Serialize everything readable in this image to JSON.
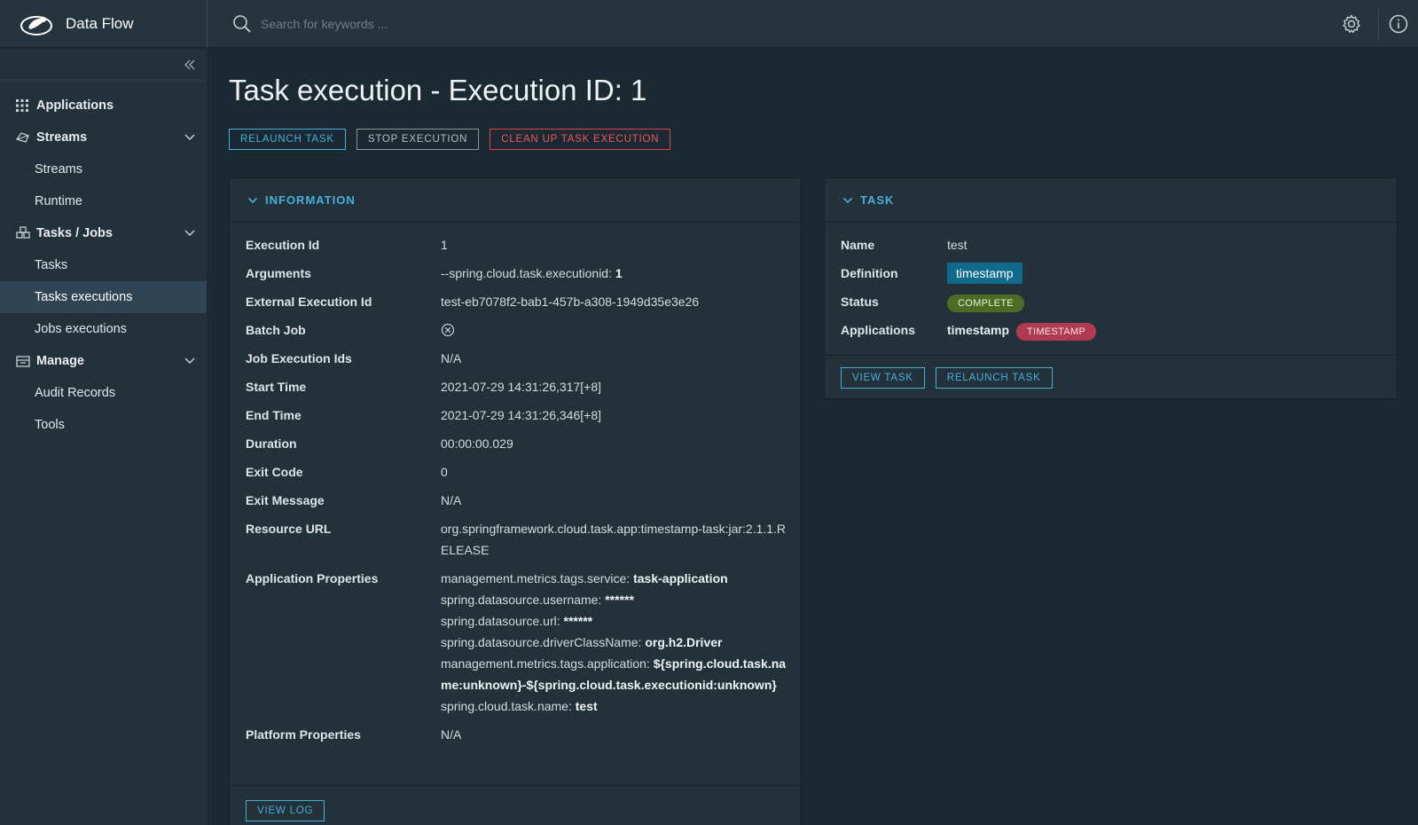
{
  "header": {
    "brand_title": "Data Flow",
    "search_placeholder": "Search for keywords ..."
  },
  "sidebar": {
    "groups": [
      {
        "label": "Applications",
        "icon": "grid-icon"
      },
      {
        "label": "Streams",
        "icon": "streams-icon",
        "items": [
          "Streams",
          "Runtime"
        ]
      },
      {
        "label": "Tasks / Jobs",
        "icon": "tasks-icon",
        "items": [
          "Tasks",
          "Tasks executions",
          "Jobs executions"
        ]
      },
      {
        "label": "Manage",
        "icon": "manage-icon",
        "items": [
          "Audit Records",
          "Tools"
        ]
      }
    ],
    "active_item": "Tasks executions"
  },
  "page": {
    "title": "Task execution - Execution ID: 1",
    "actions": {
      "relaunch": "RELAUNCH TASK",
      "stop": "STOP EXECUTION",
      "cleanup": "CLEAN UP TASK EXECUTION"
    }
  },
  "info": {
    "heading": "INFORMATION",
    "labels": {
      "execution_id": "Execution Id",
      "arguments": "Arguments",
      "external_execution_id": "External Execution Id",
      "batch_job": "Batch Job",
      "job_execution_ids": "Job Execution Ids",
      "start_time": "Start Time",
      "end_time": "End Time",
      "duration": "Duration",
      "exit_code": "Exit Code",
      "exit_message": "Exit Message",
      "resource_url": "Resource URL",
      "application_properties": "Application Properties",
      "platform_properties": "Platform Properties"
    },
    "values": {
      "execution_id": "1",
      "arguments_key": "--spring.cloud.task.executionid: ",
      "arguments_value": "1",
      "external_execution_id": "test-eb7078f2-bab1-457b-a308-1949d35e3e26",
      "batch_job": "no",
      "job_execution_ids": "N/A",
      "start_time": "2021-07-29 14:31:26,317[+8]",
      "end_time": "2021-07-29 14:31:26,346[+8]",
      "duration": "00:00:00.029",
      "exit_code": "0",
      "exit_message": "N/A",
      "resource_url": "org.springframework.cloud.task.app:timestamp-task:jar:2.1.1.RELEASE",
      "application_properties": [
        {
          "key": "management.metrics.tags.service: ",
          "value": "task-application"
        },
        {
          "key": "spring.datasource.username: ",
          "value": "******"
        },
        {
          "key": "spring.datasource.url: ",
          "value": "******"
        },
        {
          "key": "spring.datasource.driverClassName: ",
          "value": "org.h2.Driver"
        },
        {
          "key": "management.metrics.tags.application: ",
          "value": "${spring.cloud.task.name:unknown}-${spring.cloud.task.executionid:unknown}"
        },
        {
          "key": "spring.cloud.task.name: ",
          "value": "test"
        }
      ],
      "platform_properties": "N/A"
    },
    "view_log": "VIEW LOG"
  },
  "task": {
    "heading": "TASK",
    "labels": {
      "name": "Name",
      "definition": "Definition",
      "status": "Status",
      "applications": "Applications"
    },
    "name": "test",
    "definition": "timestamp",
    "status": "COMPLETE",
    "app_name": "timestamp",
    "app_type": "TIMESTAMP",
    "view_task": "VIEW TASK",
    "relaunch": "RELAUNCH TASK"
  },
  "colors": {
    "accent": "#49afd9",
    "danger": "#e0424c",
    "status_complete": "#4c6c25",
    "app_badge": "#b03a52"
  }
}
